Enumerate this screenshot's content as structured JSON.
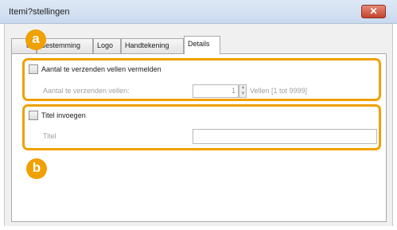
{
  "window": {
    "title": "Itemi?stellingen",
    "close_glyph": "✕"
  },
  "tabs": [
    {
      "label": "Bestemming"
    },
    {
      "label": "Logo"
    },
    {
      "label": "Handtekening"
    },
    {
      "label": "Details",
      "active": true
    }
  ],
  "tab_partial_label": "ur",
  "section_count": {
    "checkbox_label": "Aantal te verzenden vellen vermelden",
    "checked": false,
    "field_label": "Aantal te verzenden vellen:",
    "field_value": "1",
    "range_text": "Vellen [1 tot 9999]"
  },
  "section_title": {
    "checkbox_label": "Titel invoegen",
    "checked": false,
    "field_label": "Titel",
    "field_value": ""
  },
  "badges": {
    "a": "a",
    "b": "b"
  },
  "colors": {
    "highlight": "#f0a000",
    "close_button": "#c4442d"
  }
}
